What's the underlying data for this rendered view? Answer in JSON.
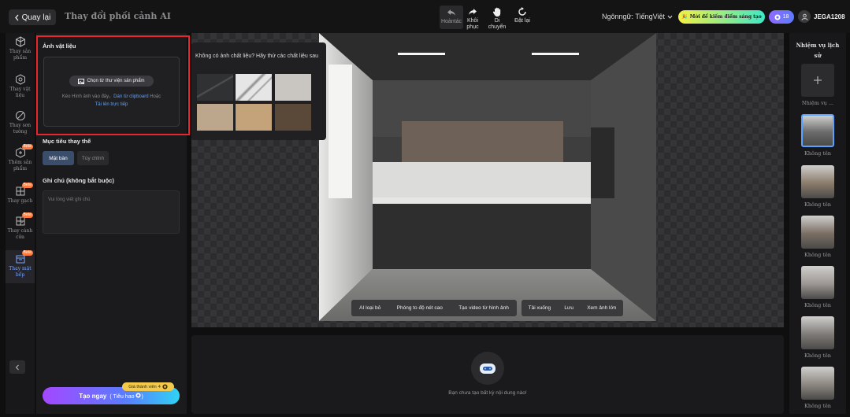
{
  "topbar": {
    "back_label": "Quay lại",
    "title": "Thay đổi phối cảnh AI",
    "tools": {
      "undo": [
        "Hoàn",
        "tác"
      ],
      "redo": [
        "Khôi",
        "phục"
      ],
      "move": [
        "Di",
        "chuyển"
      ],
      "reset": "Đặt lại"
    },
    "language": "Ngônngữ: TiếngViệt",
    "promo": "Mời để kiếm điểm sáng tạo",
    "credits": "18",
    "username": "JEGA1208"
  },
  "leftnav": {
    "beta_label": "Beta",
    "items": [
      {
        "label": "Thay sản phẩm",
        "icon": "cube-icon"
      },
      {
        "label": "Thay vật liệu",
        "icon": "material-cube-icon"
      },
      {
        "label": "Thay sơn tường",
        "icon": "paint-icon"
      },
      {
        "label": "Thêm sản phẩm",
        "icon": "add-cube-icon"
      },
      {
        "label": "Thay gạch",
        "icon": "tile-icon"
      },
      {
        "label": "Thay cánh cửa",
        "icon": "door-icon"
      },
      {
        "label": "Thay mặt bếp",
        "icon": "countertop-icon"
      }
    ]
  },
  "panel": {
    "material_title": "Ảnh vật liệu",
    "choose_button": "Chọn từ thư viện sản phẩm",
    "drop_hint_prefix": "Kéo Hình ảnh vào đây，",
    "paste_link": "Dán từ clipboard",
    "drop_hint_middle": "Hoặc",
    "upload_link": "Tải lên trực tiếp",
    "target_title": "Mục tiêu thay thế",
    "target_options": [
      "Mặt bàn",
      "Tùy chỉnh"
    ],
    "note_title": "Ghi chú (không bắt buộc)",
    "note_placeholder": "Vui lòng viết ghi chú",
    "member_tag": "Giá thành viên",
    "member_cost": "4",
    "create_button": "Tạo ngay",
    "create_cost": "( Tiêu hao",
    "create_cost_tail": ")"
  },
  "popup": {
    "text": "Không có ảnh chất liệu? Hãy thử các chất liệu sau",
    "swatches": [
      "#2f3133",
      "#e6e6e6",
      "#c9c6c2",
      "#bda78c",
      "#c4a27a",
      "#5a4838"
    ]
  },
  "canvas": {
    "left_tools": [
      "AI loại bỏ",
      "Phóng to độ nét cao",
      "Tạo video từ hình ảnh"
    ],
    "right_tools": [
      "Tải xuống",
      "Lưu",
      "Xem ảnh lớn"
    ]
  },
  "result": {
    "empty_text": "Bạn chưa tạo bất kỳ nội dung nào!"
  },
  "history": {
    "title": "Nhiệm vụ lịch sử",
    "new_task_label": "Nhiệm vụ ...",
    "items": [
      "Không tên",
      "Không tên",
      "Không tên",
      "Không tên",
      "Không tên",
      "Không tên"
    ]
  },
  "colors": {
    "accent": "#5aa2ff",
    "highlight": "#e8262e",
    "promo_from": "#f4f142",
    "promo_to": "#3ee7c6"
  }
}
